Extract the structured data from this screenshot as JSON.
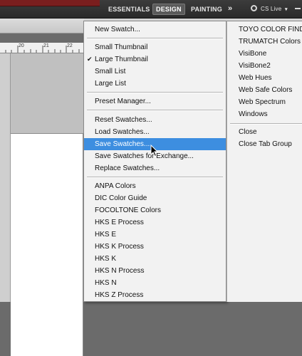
{
  "workspace_bar": {
    "essentials": "ESSENTIALS",
    "design": "DESIGN",
    "painting": "PAINTING",
    "more": "»",
    "cslive": "CS Live",
    "cslive_arrow": "▾"
  },
  "ruler": {
    "labels": [
      "20",
      "21",
      "22"
    ]
  },
  "menu": {
    "new_swatch": "New Swatch...",
    "small_thumbnail": "Small Thumbnail",
    "large_thumbnail": "Large Thumbnail",
    "large_thumbnail_check": "✔",
    "small_list": "Small List",
    "large_list": "Large List",
    "preset_manager": "Preset Manager...",
    "reset_swatches": "Reset Swatches...",
    "load_swatches": "Load Swatches...",
    "save_swatches": "Save Swatches...",
    "save_swatches_exchange": "Save Swatches for Exchange...",
    "replace_swatches": "Replace Swatches...",
    "libraries": [
      "ANPA Colors",
      "DIC Color Guide",
      "FOCOLTONE Colors",
      "HKS E Process",
      "HKS E",
      "HKS K Process",
      "HKS K",
      "HKS N Process",
      "HKS N",
      "HKS Z Process"
    ]
  },
  "submenu": {
    "libraries": [
      "TOYO COLOR FINDER",
      "TRUMATCH Colors",
      "VisiBone",
      "VisiBone2",
      "Web Hues",
      "Web Safe Colors",
      "Web Spectrum",
      "Windows"
    ],
    "close": "Close",
    "close_tab_group": "Close Tab Group"
  },
  "colors": {
    "highlight": "#3d8ee0",
    "menu_bg": "#f2f2f2",
    "app_bar": "#333333"
  }
}
